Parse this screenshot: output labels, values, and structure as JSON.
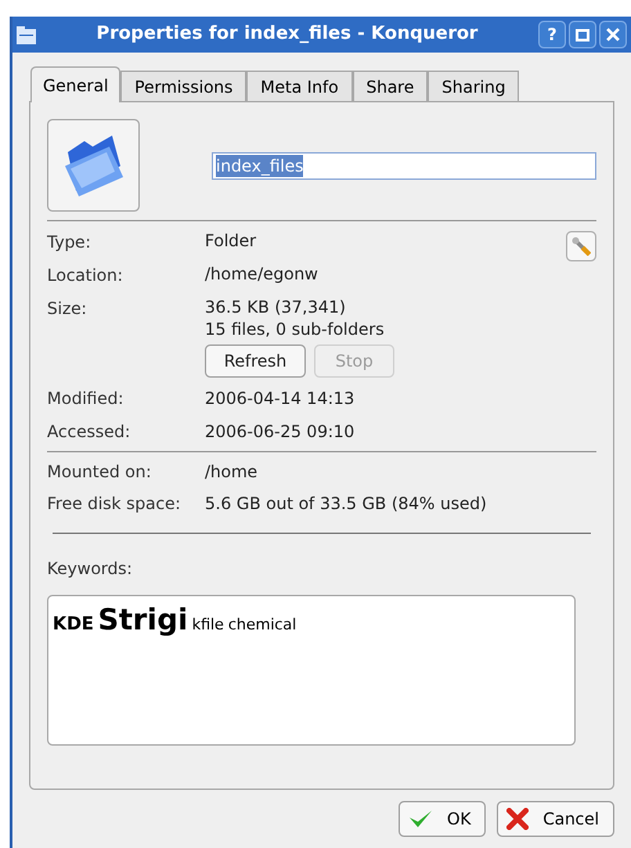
{
  "window": {
    "title": "Properties for index_files - Konqueror",
    "buttons": [
      {
        "kind": "help",
        "label": "?"
      },
      {
        "kind": "maximize"
      },
      {
        "kind": "close"
      }
    ]
  },
  "tabs": [
    {
      "label": "General",
      "selected": true
    },
    {
      "label": "Permissions",
      "selected": false
    },
    {
      "label": "Meta Info",
      "selected": false
    },
    {
      "label": "Share",
      "selected": false
    },
    {
      "label": "Sharing",
      "selected": false
    }
  ],
  "name_field": {
    "value": "index_files",
    "selected": true
  },
  "info": [
    {
      "label": "Type:",
      "lines": [
        "Folder"
      ]
    },
    {
      "label": "Location:",
      "lines": [
        "/home/egonw"
      ]
    },
    {
      "label": "Size:",
      "lines": [
        "36.5 KB (37,341)",
        "15 files, 0 sub-folders"
      ]
    }
  ],
  "size_buttons": [
    {
      "label": "Refresh",
      "disabled": false
    },
    {
      "label": "Stop",
      "disabled": true
    }
  ],
  "dates": [
    {
      "label": "Modified:",
      "value": "2006-04-14 14:13"
    },
    {
      "label": "Accessed:",
      "value": "2006-06-25 09:10"
    }
  ],
  "mount": [
    {
      "label": "Mounted on:",
      "value": "/home"
    },
    {
      "label": "Free disk space:",
      "value": "5.6 GB out of 33.5 GB (84% used)"
    }
  ],
  "keywords": {
    "label": "Keywords:",
    "tags": [
      {
        "text": "KDE",
        "kind": "medium"
      },
      {
        "text": "Strigi",
        "kind": "large"
      },
      {
        "text": "kfile",
        "kind": "small"
      },
      {
        "text": "chemical",
        "kind": "small"
      }
    ]
  },
  "dialog_buttons": [
    {
      "kind": "ok",
      "label": "OK"
    },
    {
      "kind": "cancel",
      "label": "Cancel"
    }
  ]
}
